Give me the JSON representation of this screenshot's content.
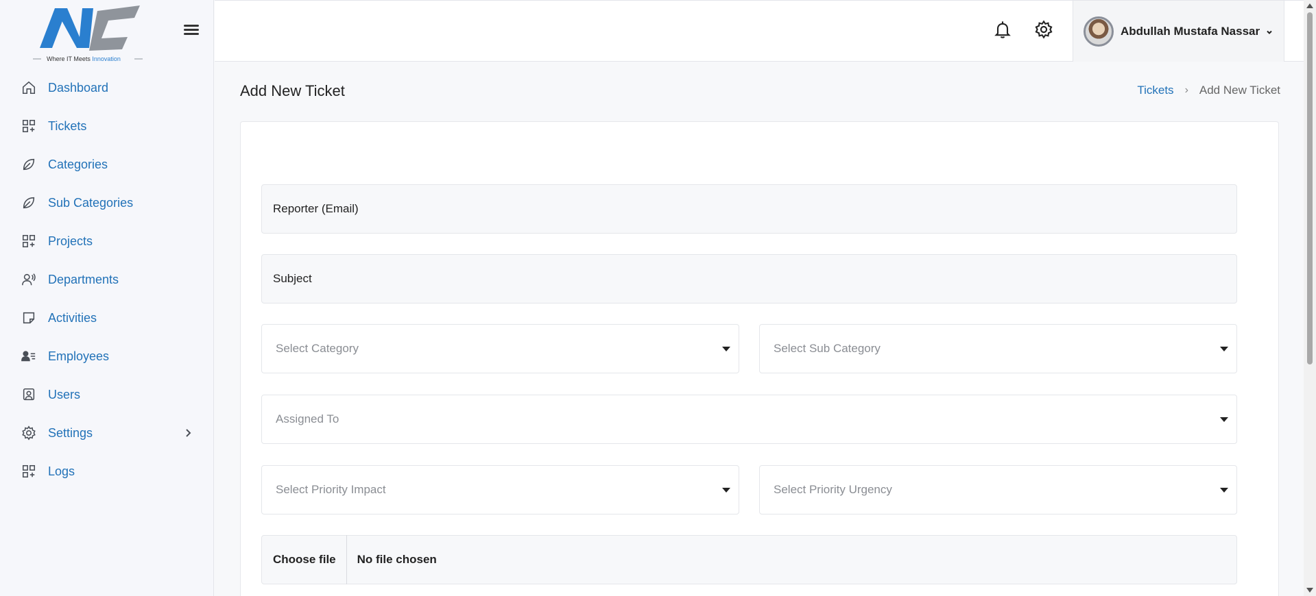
{
  "logo": {
    "text_main": "NC",
    "tagline_prefix": "Where IT Meets ",
    "tagline_highlight": "Innovation"
  },
  "sidebar": {
    "items": [
      {
        "label": "Dashboard",
        "icon": "home-icon"
      },
      {
        "label": "Tickets",
        "icon": "grid-plus-icon"
      },
      {
        "label": "Categories",
        "icon": "leaf-icon"
      },
      {
        "label": "Sub Categories",
        "icon": "leaf-icon"
      },
      {
        "label": "Projects",
        "icon": "grid-plus-icon"
      },
      {
        "label": "Departments",
        "icon": "user-voice-icon"
      },
      {
        "label": "Activities",
        "icon": "sticky-note-icon"
      },
      {
        "label": "Employees",
        "icon": "user-list-icon"
      },
      {
        "label": "Users",
        "icon": "user-badge-icon"
      },
      {
        "label": "Settings",
        "icon": "gear-icon"
      },
      {
        "label": "Logs",
        "icon": "grid-plus-icon"
      }
    ]
  },
  "header": {
    "user_name": "Abdullah Mustafa Nassar"
  },
  "page": {
    "title": "Add New Ticket",
    "breadcrumb": {
      "parent": "Tickets",
      "current": "Add New Ticket"
    }
  },
  "form": {
    "reporter_email": "Reporter (Email)",
    "subject": "Subject",
    "category_placeholder": "Select Category",
    "sub_category_placeholder": "Select Sub Category",
    "assigned_to_placeholder": "Assigned To",
    "priority_impact_placeholder": "Select Priority Impact",
    "priority_urgency_placeholder": "Select Priority Urgency",
    "file_button": "Choose file",
    "file_status": "No file chosen"
  },
  "colors": {
    "link": "#2272b8",
    "logo_blue": "#2a7fcf",
    "logo_grey": "#8f949b"
  }
}
